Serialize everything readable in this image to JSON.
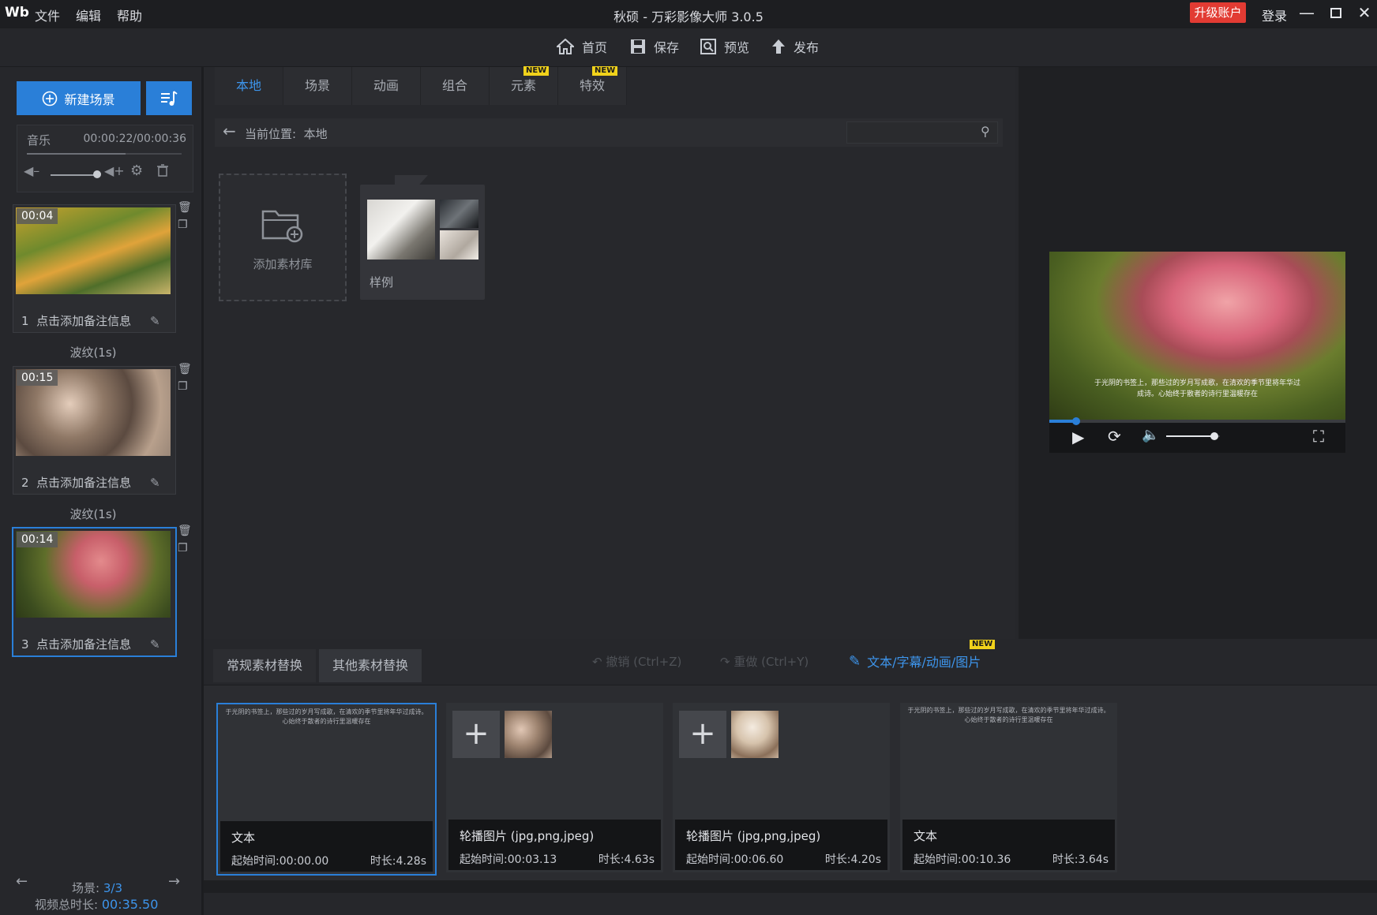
{
  "app": {
    "logo": "Wb",
    "title": "秋硕 - 万彩影像大师 3.0.5",
    "menus": [
      "文件",
      "编辑",
      "帮助"
    ],
    "upgrade_label": "升级账户",
    "login_label": "登录"
  },
  "toolbar": {
    "home": "首页",
    "save": "保存",
    "preview": "预览",
    "publish": "发布"
  },
  "left": {
    "new_scene": "新建场景",
    "music_label": "音乐",
    "music_time": "00:00:22/00:00:36",
    "scenes": [
      {
        "time": "00:04",
        "index": "1",
        "note": "点击添加备注信息"
      },
      {
        "time": "00:15",
        "index": "2",
        "note": "点击添加备注信息"
      },
      {
        "time": "00:14",
        "index": "3",
        "note": "点击添加备注信息"
      }
    ],
    "transitions": [
      "波纹(1s)",
      "波纹(1s)"
    ],
    "footer_scene_label": "场景:",
    "footer_scene_value": "3/3",
    "footer_total_label": "视频总时长:",
    "footer_total_value": "00:35.50"
  },
  "library": {
    "tabs": [
      "本地",
      "场景",
      "动画",
      "组合",
      "元素",
      "特效"
    ],
    "new_badge": "NEW",
    "path_label": "当前位置:",
    "path_value": "本地",
    "search_placeholder": "",
    "add_library": "添加素材库",
    "sample": "样例"
  },
  "preview": {
    "caption_line1": "于光阴的书签上，那些过的岁月写成歌，在清欢的季节里将年华过",
    "caption_line2": "成诗。心始终于散者的诗行里温暖存在",
    "progress": 0.09,
    "volume": 0.9
  },
  "bottom": {
    "tabs": [
      "常规素材替换",
      "其他素材替换"
    ],
    "undo": "撤销 (Ctrl+Z)",
    "redo": "重做 (Ctrl+Y)",
    "text_subtitle": "文本/字幕/动画/图片",
    "new_badge": "NEW",
    "clips": [
      {
        "title": "文本",
        "start": "起始时间:00:00.00",
        "duration": "时长:4.28s",
        "text": "于光阴的书签上，那些过的岁月写成歌，在清欢的季节里将年华过成诗。心始终于散者的诗行里温暖存在"
      },
      {
        "title": "轮播图片 (jpg,png,jpeg)",
        "start": "起始时间:00:03.13",
        "duration": "时长:4.63s"
      },
      {
        "title": "轮播图片 (jpg,png,jpeg)",
        "start": "起始时间:00:06.60",
        "duration": "时长:4.20s"
      },
      {
        "title": "文本",
        "start": "起始时间:00:10.36",
        "duration": "时长:3.64s",
        "text": "于光阴的书签上，那些过的岁月写成歌，在清欢的季节里将年华过成诗。心始终于散者的诗行里温暖存在"
      }
    ]
  },
  "colors": {
    "accent": "#2a7fd8",
    "upgrade": "#e23b33",
    "background": "#26272b"
  }
}
